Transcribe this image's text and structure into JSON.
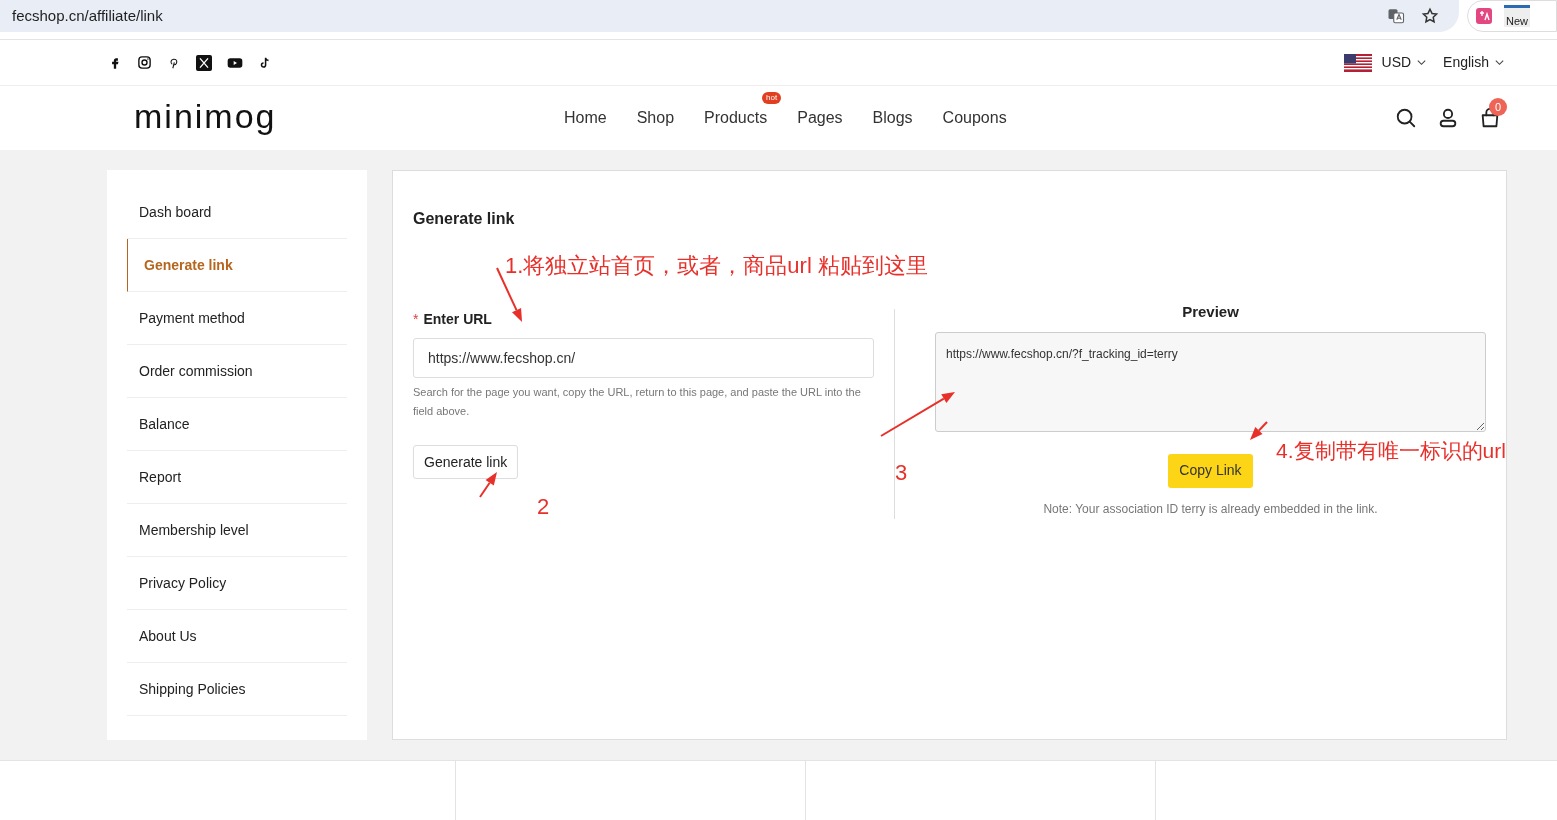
{
  "browser": {
    "url": "fecshop.cn/affiliate/link",
    "extension_badge": "New"
  },
  "topbar": {
    "currency": "USD",
    "language": "English"
  },
  "header": {
    "logo": "minimog",
    "nav": [
      {
        "label": "Home"
      },
      {
        "label": "Shop"
      },
      {
        "label": "Products",
        "badge": "hot"
      },
      {
        "label": "Pages"
      },
      {
        "label": "Blogs"
      },
      {
        "label": "Coupons"
      }
    ],
    "cart_count": "0"
  },
  "sidebar": {
    "items": [
      {
        "label": "Dash board",
        "selected": false
      },
      {
        "label": "Generate link",
        "selected": true
      },
      {
        "label": "Payment method",
        "selected": false
      },
      {
        "label": "Order commission",
        "selected": false
      },
      {
        "label": "Balance",
        "selected": false
      },
      {
        "label": "Report",
        "selected": false
      },
      {
        "label": "Membership level",
        "selected": false
      },
      {
        "label": "Privacy Policy",
        "selected": false
      },
      {
        "label": "About Us",
        "selected": false
      },
      {
        "label": "Shipping Policies",
        "selected": false
      }
    ]
  },
  "panel": {
    "title": "Generate link",
    "required_mark": "*",
    "url_label": "Enter URL",
    "url_value": "https://www.fecshop.cn/",
    "help": "Search for the page you want, copy the URL, return to this page, and paste the URL into the field above.",
    "generate_button": "Generate link",
    "preview_title": "Preview",
    "preview_value": "https://www.fecshop.cn/?f_tracking_id=terry",
    "copy_button": "Copy Link",
    "note": "Note: Your association ID terry is already embedded in the link."
  },
  "annotations": [
    {
      "text": "1.将独立站首页，或者，商品url 粘贴到这里"
    },
    {
      "text": "2"
    },
    {
      "text": "3"
    },
    {
      "text": "4.复制带有唯一标识的url"
    }
  ]
}
